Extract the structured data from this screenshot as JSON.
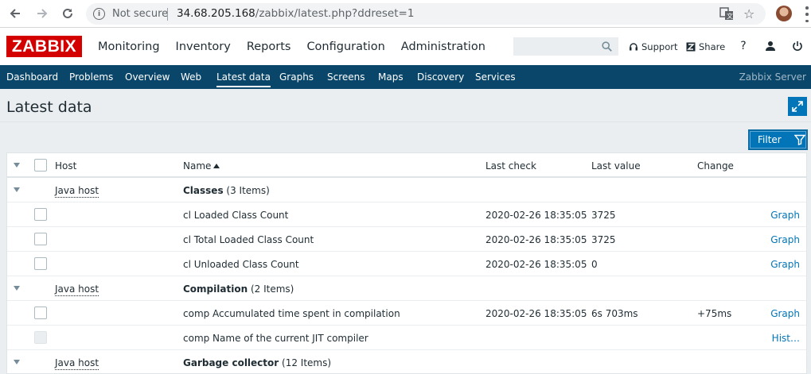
{
  "browser": {
    "security_label": "Not secure",
    "url_host": "34.68.205.168",
    "url_path": "/zabbix/latest.php?ddreset=1"
  },
  "header": {
    "logo": "ZABBIX",
    "menu": [
      "Monitoring",
      "Inventory",
      "Reports",
      "Configuration",
      "Administration"
    ],
    "support_label": "Support",
    "share_label": "Share",
    "help_label": "?"
  },
  "submenu": {
    "items": [
      "Dashboard",
      "Problems",
      "Overview",
      "Web",
      "Latest data",
      "Graphs",
      "Screens",
      "Maps",
      "Discovery",
      "Services"
    ],
    "active": "Latest data",
    "server_name": "Zabbix Server"
  },
  "page": {
    "title": "Latest data",
    "filter_label": "Filter"
  },
  "table": {
    "headers": {
      "host": "Host",
      "name": "Name",
      "last_check": "Last check",
      "last_value": "Last value",
      "change": "Change"
    },
    "rows": [
      {
        "kind": "group",
        "host": "Java host",
        "group": "Classes",
        "count": "(3 Items)"
      },
      {
        "kind": "item",
        "name": "cl Loaded Class Count",
        "last_check": "2020-02-26 18:35:05",
        "last_value": "3725",
        "change": "",
        "action": "Graph"
      },
      {
        "kind": "item",
        "name": "cl Total Loaded Class Count",
        "last_check": "2020-02-26 18:35:05",
        "last_value": "3725",
        "change": "",
        "action": "Graph"
      },
      {
        "kind": "item",
        "name": "cl Unloaded Class Count",
        "last_check": "2020-02-26 18:35:05",
        "last_value": "0",
        "change": "",
        "action": "Graph"
      },
      {
        "kind": "group",
        "host": "Java host",
        "group": "Compilation",
        "count": "(2 Items)"
      },
      {
        "kind": "item",
        "name": "comp Accumulated time spent in compilation",
        "last_check": "2020-02-26 18:35:05",
        "last_value": "6s 703ms",
        "change": "+75ms",
        "action": "Graph"
      },
      {
        "kind": "item",
        "name": "comp Name of the current JIT compiler",
        "last_check": "",
        "last_value": "",
        "change": "",
        "action": "Hist…"
      },
      {
        "kind": "group",
        "host": "Java host",
        "group": "Garbage collector",
        "count": "(12 Items)"
      }
    ]
  }
}
